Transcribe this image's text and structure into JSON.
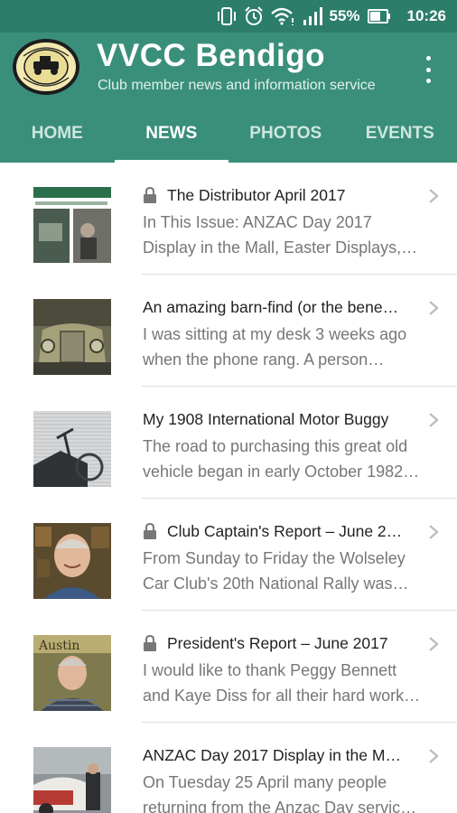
{
  "status_bar": {
    "battery_percent": "55%",
    "time": "10:26",
    "icons": [
      "vibrate-icon",
      "alarm-icon",
      "wifi-icon",
      "signal-icon",
      "battery-icon"
    ]
  },
  "app_bar": {
    "title": "VVCC Bendigo",
    "subtitle": "Club member news and information service",
    "logo": "vvcc-club-badge-logo",
    "colors": {
      "primary": "#3a8f7a",
      "status": "#2c7d69"
    }
  },
  "tabs": [
    {
      "label": "HOME",
      "active": false
    },
    {
      "label": "NEWS",
      "active": true
    },
    {
      "label": "PHOTOS",
      "active": false
    },
    {
      "label": "EVENTS",
      "active": false
    }
  ],
  "news": [
    {
      "title": "The Distributor April 2017",
      "locked": true,
      "summary_line1": "In This Issue: ANZAC Day 2017",
      "summary_line2": "Display in the Mall, Easter Displays,…"
    },
    {
      "title": "An amazing barn-find (or the bene…",
      "locked": false,
      "summary_line1": "I was sitting at my desk 3 weeks ago",
      "summary_line2": "when the phone rang. A person…"
    },
    {
      "title": "My 1908 International Motor Buggy",
      "locked": false,
      "summary_line1": "The road to purchasing this great old",
      "summary_line2": "vehicle began in early October 1982…"
    },
    {
      "title": "Club Captain's Report – June 2…",
      "locked": true,
      "summary_line1": "From Sunday to Friday the Wolseley",
      "summary_line2": "Car Club's 20th National Rally was…"
    },
    {
      "title": "President's Report – June 2017",
      "locked": true,
      "summary_line1": "I would like to thank Peggy Bennett",
      "summary_line2": "and Kaye Diss for all their hard work…"
    },
    {
      "title": "ANZAC Day 2017 Display in the M…",
      "locked": false,
      "summary_line1": "On Tuesday 25 April many people",
      "summary_line2": "returning from the Anzac Day servic…"
    }
  ]
}
